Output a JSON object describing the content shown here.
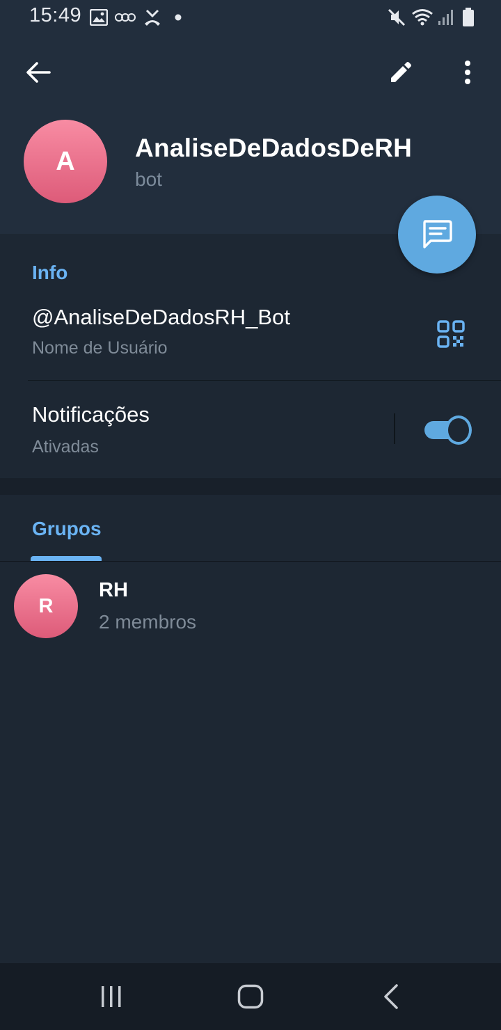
{
  "status_bar": {
    "time": "15:49",
    "icons": [
      "gallery-icon",
      "voicemail-icon",
      "missed-call-icon",
      "dot-icon",
      "mute-icon",
      "wifi-icon",
      "signal-icon",
      "battery-icon"
    ]
  },
  "toolbar": {
    "back_icon": "arrow-left-icon",
    "edit_icon": "pencil-icon",
    "more_icon": "more-vertical-icon"
  },
  "profile": {
    "avatar_letter": "A",
    "name": "AnaliseDeDadosDeRH",
    "subtitle": "bot",
    "fab_icon": "message-icon"
  },
  "info": {
    "title": "Info",
    "username": "@AnaliseDeDadosRH_Bot",
    "username_label": "Nome de Usuário",
    "qr_icon": "qr-code-icon",
    "notifications_label": "Notificações",
    "notifications_status": "Ativadas",
    "notifications_enabled": true
  },
  "groups": {
    "tab_label": "Grupos",
    "items": [
      {
        "avatar_letter": "R",
        "name": "RH",
        "members": "2 membros"
      }
    ]
  },
  "nav_bar": {
    "icons": [
      "recent-apps-icon",
      "home-icon",
      "back-icon"
    ]
  },
  "colors": {
    "background": "#1d2733",
    "header": "#222e3d",
    "accent": "#6ab3f3",
    "fab": "#5fa9e0",
    "avatar_gradient_top": "#f88ca3",
    "avatar_gradient_bottom": "#dd5b79",
    "secondary_text": "#7f8b98"
  }
}
